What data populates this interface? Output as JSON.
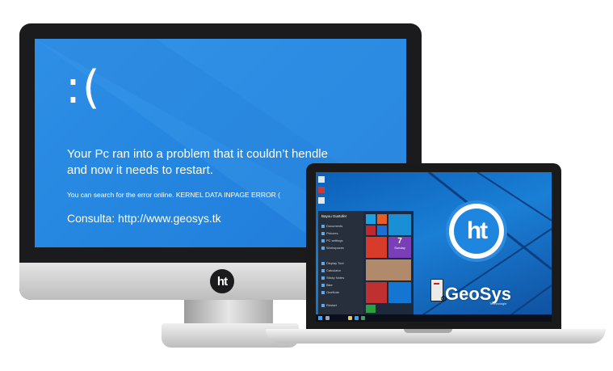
{
  "monitor": {
    "logo_text": "ht",
    "bsod": {
      "face": ":(",
      "main_line1": "Your Pc ran into a problem that it couldn’t hendle",
      "main_line2": "and now it needs to restart.",
      "sub": "You can search for the error online. KERNEL DATA INPAGE ERROR (",
      "link": "Consulta: http://www.geosys.tk"
    }
  },
  "laptop": {
    "badge_text": "ht",
    "brand": "GeoSys",
    "brand_tag": "Technologie",
    "start_menu": {
      "user": "Bayou Gustofer",
      "items": [
        "Documents",
        "Pictures",
        "PC settings",
        "Workspaces",
        "Display Tool",
        "Calculator",
        "Sticky Notes",
        "Bike",
        "OneNote"
      ],
      "power": "Restart"
    },
    "calendar_tile": "7",
    "calendar_day": "Sunday"
  },
  "colors": {
    "bsod_blue": "#2586e0",
    "bezel": "#1b1b1d",
    "win_blue": "#1a7fd6"
  }
}
